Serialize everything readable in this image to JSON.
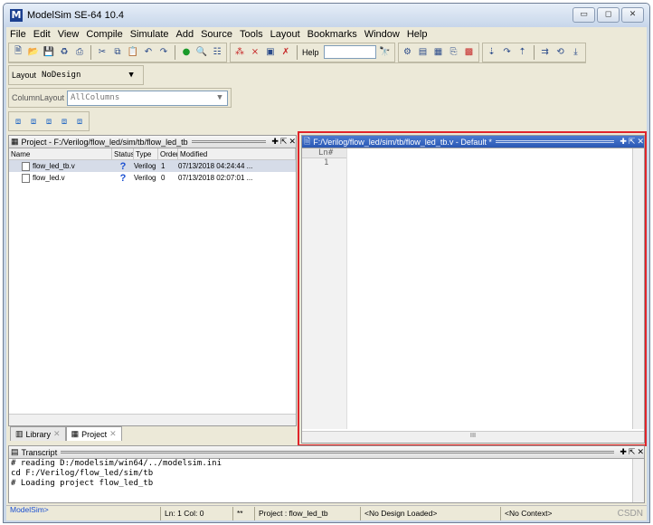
{
  "window": {
    "title": "ModelSim SE-64 10.4",
    "icon_letter": "M"
  },
  "menu": [
    "File",
    "Edit",
    "View",
    "Compile",
    "Simulate",
    "Add",
    "Source",
    "Tools",
    "Layout",
    "Bookmarks",
    "Window",
    "Help"
  ],
  "toolbar": {
    "help_label": "Help"
  },
  "layout": {
    "label": "Layout",
    "value": "NoDesign"
  },
  "column_layout": {
    "label": "ColumnLayout",
    "value": "AllColumns"
  },
  "project_pane": {
    "title": "Project - F:/Verilog/flow_led/sim/tb/flow_led_tb",
    "columns": [
      "Name",
      "Status",
      "Type",
      "Order",
      "Modified"
    ],
    "files": [
      {
        "name": "flow_led_tb.v",
        "status": "?",
        "type": "Verilog",
        "order": "1",
        "modified": "07/13/2018 04:24:44 ..."
      },
      {
        "name": "flow_led.v",
        "status": "?",
        "type": "Verilog",
        "order": "0",
        "modified": "07/13/2018 02:07:01 ..."
      }
    ]
  },
  "tabs": {
    "library": "Library",
    "project": "Project"
  },
  "editor": {
    "title": "F:/Verilog/flow_led/sim/tb/flow_led_tb.v - Default *",
    "ln_header": "Ln#",
    "line1": "1",
    "hscroll_mark": "III"
  },
  "transcript": {
    "title": "Transcript",
    "lines": [
      "# reading D:/modelsim/win64/../modelsim.ini",
      "cd F:/Verilog/flow_led/sim/tb",
      "# Loading project flow_led_tb"
    ],
    "prompt": "ModelSim>"
  },
  "status": {
    "lncol": "Ln:  1 Col: 0",
    "stars": "**",
    "project": "Project : flow_led_tb",
    "design": "<No Design Loaded>",
    "context": "<No Context>",
    "watermark": "CSDN @Vizio_"
  },
  "colors": {
    "highlight": "#e0242a"
  }
}
